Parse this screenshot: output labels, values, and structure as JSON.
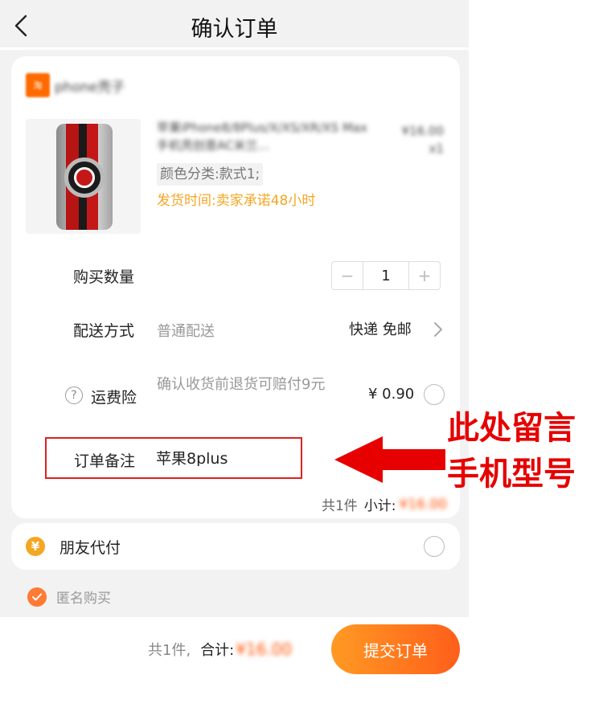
{
  "header": {
    "title": "确认订单"
  },
  "shop": {
    "name": "phone壳子",
    "logo_text": "淘"
  },
  "product": {
    "title": "苹果iPhone8/8Plus/X/XS/XR/XS Max手机壳创意AC米兰…",
    "price": "¥16.00",
    "quantity_x": "x1",
    "sku": "颜色分类:款式1;",
    "ship_time": "发货时间:卖家承诺48小时"
  },
  "quantity": {
    "label": "购买数量",
    "value": "1",
    "minus": "−",
    "plus": "+"
  },
  "delivery": {
    "label": "配送方式",
    "value": "普通配送",
    "method": "快递 免邮"
  },
  "insurance": {
    "label": "运费险",
    "description": "确认收货前退货可赔付9元",
    "price": "¥ 0.90",
    "help_symbol": "?"
  },
  "note": {
    "label": "订单备注",
    "value": "苹果8plus"
  },
  "summary": {
    "count": "共1件",
    "subtotal_label": "小计:",
    "subtotal_amount": "¥16.00"
  },
  "friend_pay": {
    "label": "朋友代付",
    "icon_symbol": "¥"
  },
  "anonymous": {
    "label": "匿名购买",
    "checked": true
  },
  "footer": {
    "count": "共1件,",
    "total_label": "合计:",
    "total_amount": "¥16.00",
    "submit_label": "提交订单"
  },
  "annotation": {
    "line1": "此处留言",
    "line2": "手机型号"
  },
  "colors": {
    "accent": "#ff5000",
    "button_start": "#ff9a23",
    "button_end": "#ff5e1a",
    "warning": "#f5a623",
    "annotation_red": "#e60000"
  }
}
